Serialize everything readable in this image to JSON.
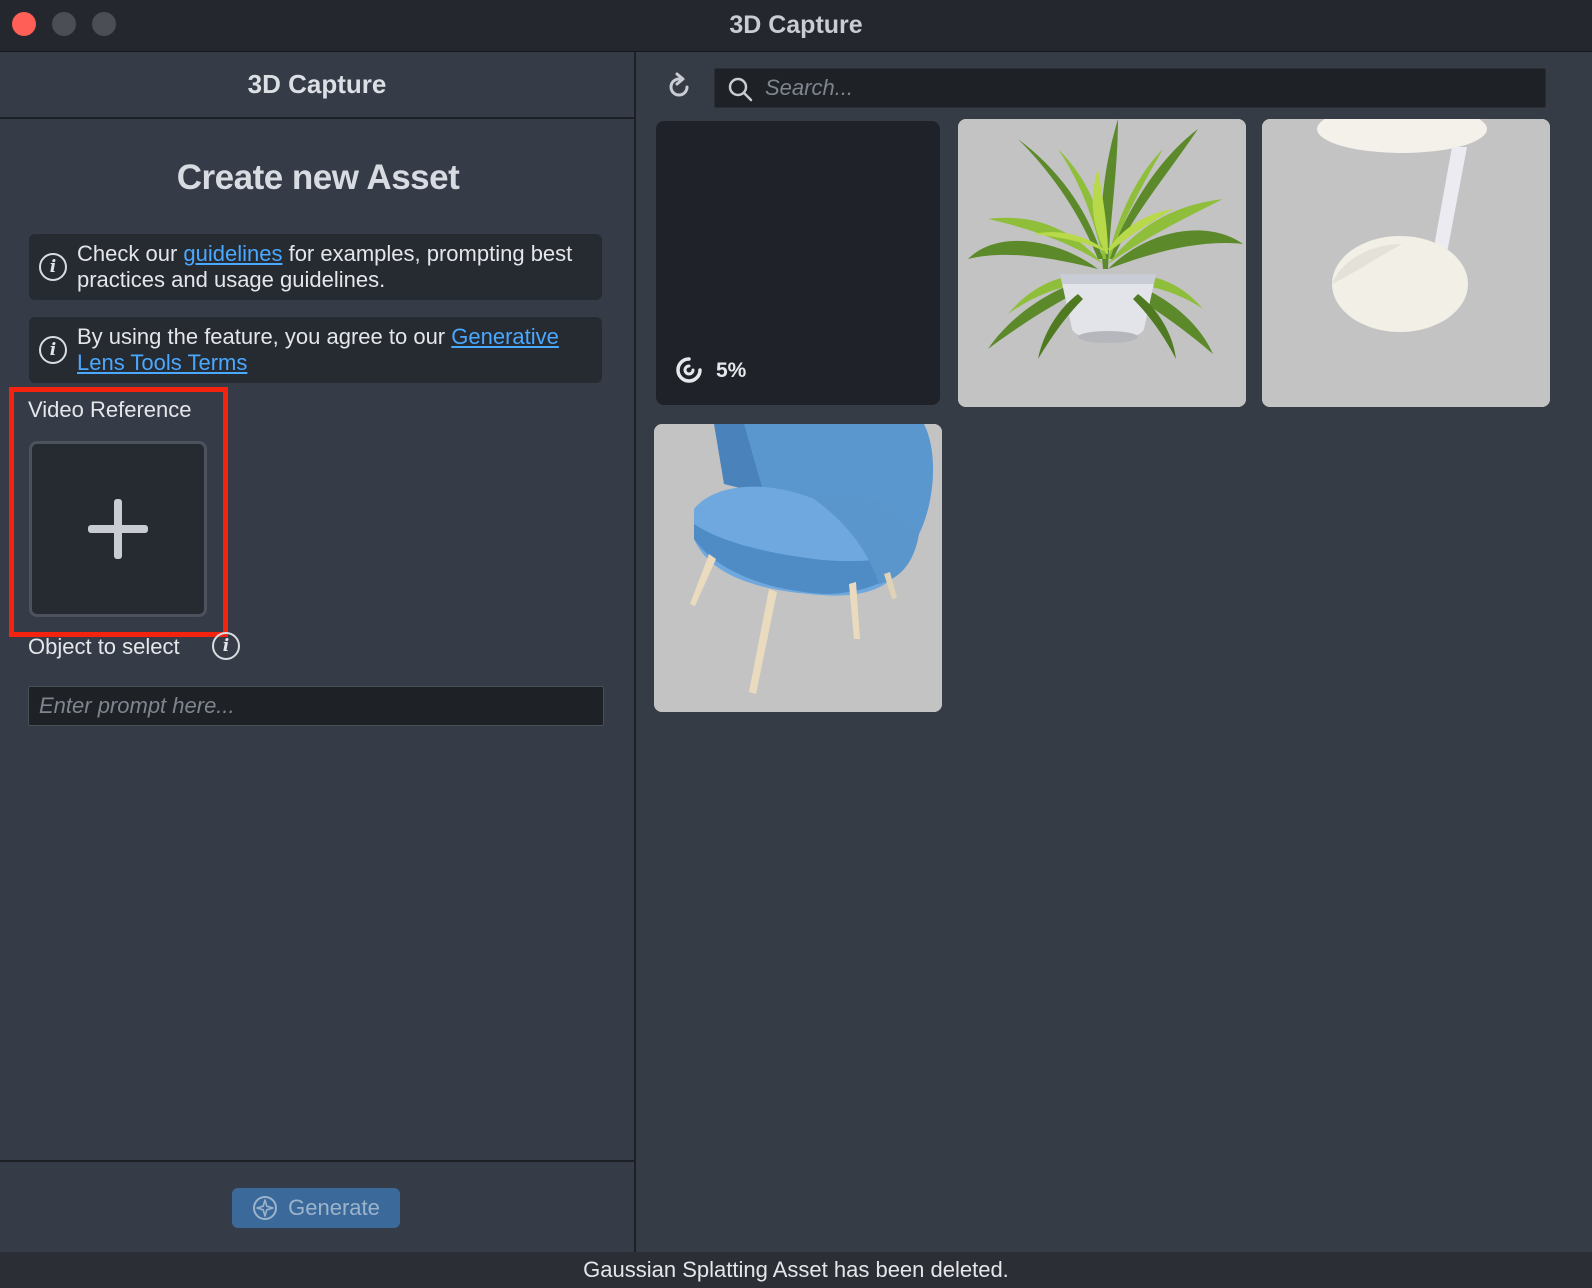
{
  "window": {
    "title": "3D Capture",
    "controls": [
      "close",
      "minimize",
      "maximize"
    ],
    "close_color": "#ff5f57"
  },
  "left_panel": {
    "header": "3D Capture",
    "create_title": "Create new Asset",
    "notice_guidelines": {
      "before": "Check our ",
      "link": "guidelines",
      "after": " for examples, prompting best practices and usage guidelines."
    },
    "notice_terms": {
      "before": "By using the feature, you agree to our ",
      "link": "Generative Lens Tools Terms"
    },
    "video_reference_label": "Video Reference",
    "object_label": "Object to select",
    "prompt_placeholder": "Enter prompt here...",
    "generate_label": "Generate",
    "accent_color": "#3b6a9a",
    "link_color": "#4aa8ff",
    "highlight_color": "#f3230f"
  },
  "right_panel": {
    "search_placeholder": "Search...",
    "assets": [
      {
        "kind": "in-progress",
        "progress": 0.05,
        "progress_label": "5%"
      },
      {
        "kind": "thumbnail",
        "subject": "potted plant"
      },
      {
        "kind": "thumbnail",
        "subject": "side table"
      },
      {
        "kind": "thumbnail",
        "subject": "blue chair"
      }
    ]
  },
  "status_bar": {
    "message": "Gaussian Splatting Asset has been deleted."
  },
  "icons": [
    "info-icon",
    "plus-icon",
    "refresh-icon",
    "search-icon",
    "progress-icon",
    "generate-icon"
  ]
}
